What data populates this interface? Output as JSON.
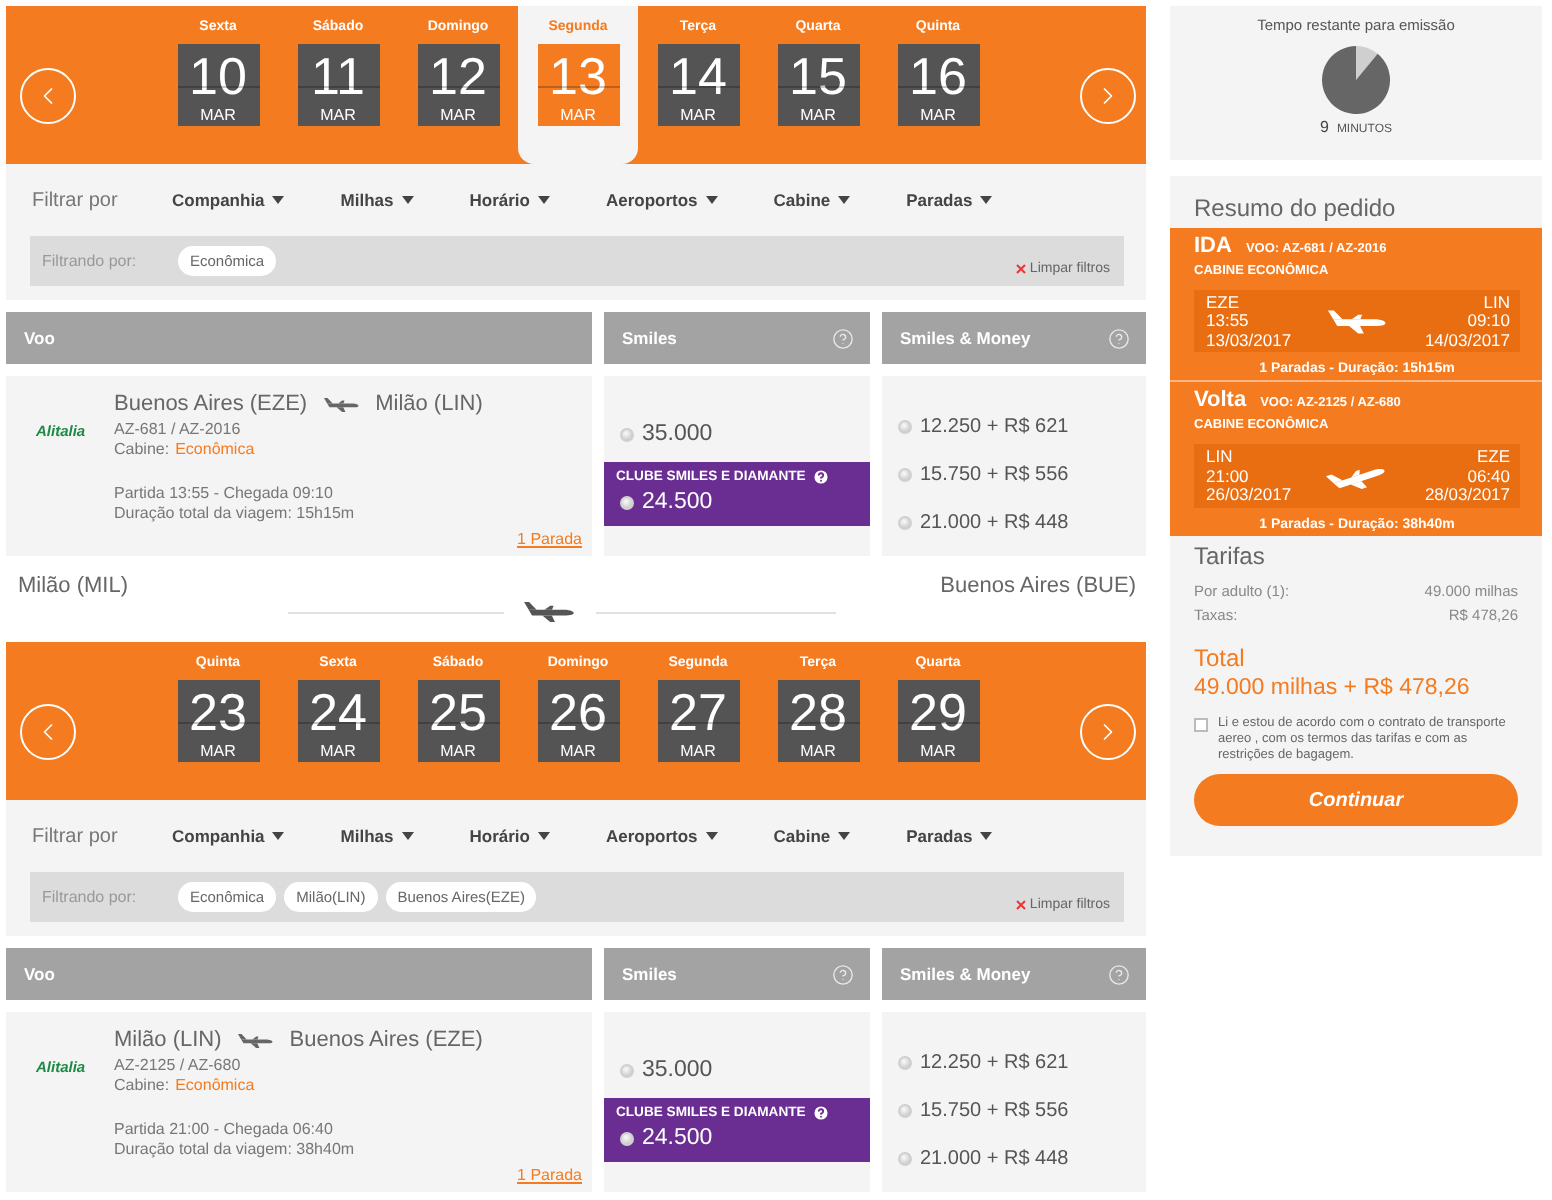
{
  "legs": [
    {
      "date_strip": {
        "days": [
          {
            "weekday": "Sexta",
            "day": "10",
            "month": "MAR",
            "selected": false
          },
          {
            "weekday": "Sábado",
            "day": "11",
            "month": "MAR",
            "selected": false
          },
          {
            "weekday": "Domingo",
            "day": "12",
            "month": "MAR",
            "selected": false
          },
          {
            "weekday": "Segunda",
            "day": "13",
            "month": "MAR",
            "selected": true
          },
          {
            "weekday": "Terça",
            "day": "14",
            "month": "MAR",
            "selected": false
          },
          {
            "weekday": "Quarta",
            "day": "15",
            "month": "MAR",
            "selected": false
          },
          {
            "weekday": "Quinta",
            "day": "16",
            "month": "MAR",
            "selected": false
          }
        ]
      },
      "filters": {
        "label": "Filtrar por",
        "options": [
          "Companhia",
          "Milhas",
          "Horário",
          "Aeroportos",
          "Cabine",
          "Paradas"
        ],
        "active_label": "Filtrando por:",
        "chips": [
          "Econômica"
        ],
        "clear": "Limpar filtros"
      },
      "columns": [
        {
          "label": "Voo",
          "help": false
        },
        {
          "label": "Smiles",
          "help": true
        },
        {
          "label": "Smiles & Money",
          "help": true
        }
      ],
      "flight": {
        "airline": "Alitalia",
        "origin": "Buenos Aires (EZE)",
        "destination": "Milão (LIN)",
        "numbers": "AZ-681 / AZ-2016",
        "cabin_label": "Cabine:",
        "cabin": "Econômica",
        "times": "Partida 13:55 - Chegada 09:10",
        "duration": "Duração total da viagem: 15h15m",
        "stops": "1 Parada",
        "smiles": [
          {
            "kind": "standard",
            "price": "35.000",
            "selected": false
          },
          {
            "kind": "club",
            "label": "CLUBE SMILES E DIAMANTE",
            "price": "24.500",
            "selected": false
          }
        ],
        "smiles_money": [
          {
            "price": "12.250 + R$ 621",
            "selected": false
          },
          {
            "price": "15.750 + R$ 556",
            "selected": false
          },
          {
            "price": "21.000 + R$ 448",
            "selected": false
          }
        ]
      }
    },
    {
      "route": {
        "origin": "Milão (MIL)",
        "destination": "Buenos Aires (BUE)"
      },
      "date_strip": {
        "days": [
          {
            "weekday": "Quinta",
            "day": "23",
            "month": "MAR",
            "selected": false
          },
          {
            "weekday": "Sexta",
            "day": "24",
            "month": "MAR",
            "selected": false
          },
          {
            "weekday": "Sábado",
            "day": "25",
            "month": "MAR",
            "selected": false
          },
          {
            "weekday": "Domingo",
            "day": "26",
            "month": "MAR",
            "selected": false
          },
          {
            "weekday": "Segunda",
            "day": "27",
            "month": "MAR",
            "selected": false
          },
          {
            "weekday": "Terça",
            "day": "28",
            "month": "MAR",
            "selected": false
          },
          {
            "weekday": "Quarta",
            "day": "29",
            "month": "MAR",
            "selected": false
          }
        ]
      },
      "filters": {
        "label": "Filtrar por",
        "options": [
          "Companhia",
          "Milhas",
          "Horário",
          "Aeroportos",
          "Cabine",
          "Paradas"
        ],
        "active_label": "Filtrando por:",
        "chips": [
          "Econômica",
          "Milão(LIN)",
          "Buenos Aires(EZE)"
        ],
        "clear": "Limpar filtros"
      },
      "columns": [
        {
          "label": "Voo",
          "help": false
        },
        {
          "label": "Smiles",
          "help": true
        },
        {
          "label": "Smiles & Money",
          "help": true
        }
      ],
      "flight": {
        "airline": "Alitalia",
        "origin": "Milão (LIN)",
        "destination": "Buenos Aires (EZE)",
        "numbers": "AZ-2125 / AZ-680",
        "cabin_label": "Cabine:",
        "cabin": "Econômica",
        "times": "Partida 21:00 - Chegada 06:40",
        "duration": "Duração total da viagem: 38h40m",
        "stops": "1 Parada",
        "smiles": [
          {
            "kind": "standard",
            "price": "35.000",
            "selected": false
          },
          {
            "kind": "club",
            "label": "CLUBE SMILES E DIAMANTE",
            "price": "24.500",
            "selected": false
          }
        ],
        "smiles_money": [
          {
            "price": "12.250 + R$ 621",
            "selected": false
          },
          {
            "price": "15.750 + R$ 556",
            "selected": false
          },
          {
            "price": "21.000 + R$ 448",
            "selected": false
          }
        ]
      }
    }
  ],
  "sidebar": {
    "timer": {
      "label": "Tempo restante para emissão",
      "value": "9",
      "unit": "MINUTOS"
    },
    "summary": {
      "title": "Resumo do pedido",
      "legs": [
        {
          "kind": "outbound",
          "direction": "IDA",
          "flight": "VOO: AZ-681 / AZ-2016",
          "cabin": "CABINE ECONÔMICA",
          "origin": {
            "code": "EZE",
            "time": "13:55",
            "date": "13/03/2017"
          },
          "destination": {
            "code": "LIN",
            "time": "09:10",
            "date": "14/03/2017"
          },
          "info": "1 Paradas - Duração: 15h15m"
        },
        {
          "kind": "return",
          "direction": "Volta",
          "flight": "VOO: AZ-2125 / AZ-680",
          "cabin": "CABINE ECONÔMICA",
          "origin": {
            "code": "LIN",
            "time": "21:00",
            "date": "26/03/2017"
          },
          "destination": {
            "code": "EZE",
            "time": "06:40",
            "date": "28/03/2017"
          },
          "info": "1 Paradas - Duração: 38h40m"
        }
      ],
      "fares_title": "Tarifas",
      "fares": [
        {
          "label": "Por adulto (1):",
          "value": "49.000 milhas"
        },
        {
          "label": "Taxas:",
          "value": "R$ 478,26"
        }
      ],
      "total_label": "Total",
      "total": "49.000 milhas + R$ 478,26",
      "terms": {
        "text": "Li e estou de acordo com o contrato de transporte aereo , com os termos das tarifas e com as restrições de bagagem.",
        "checked": false
      },
      "button": "Continuar"
    }
  }
}
